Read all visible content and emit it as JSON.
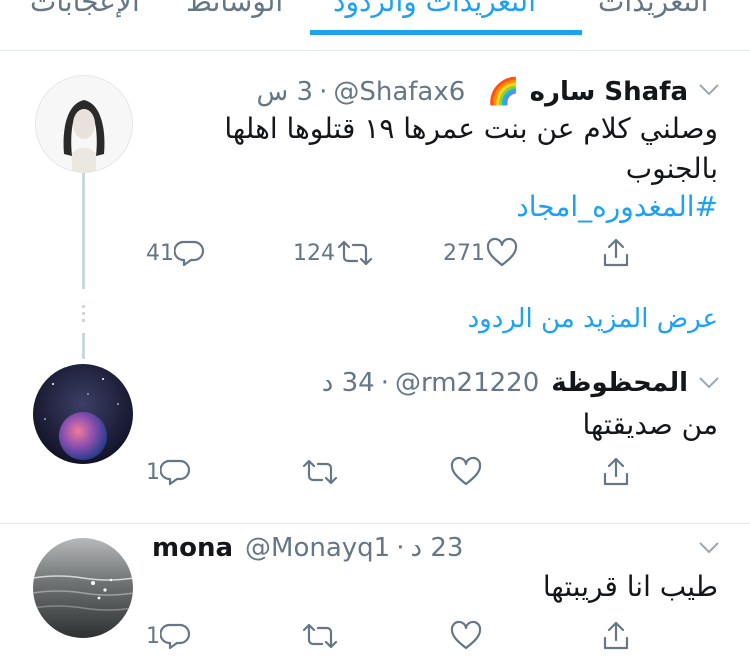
{
  "tabs": [
    "الإعجابات",
    "الوسائط",
    "التغريدات والردود",
    "التغريدات"
  ],
  "main_tweet": {
    "name": "Shafa ساره",
    "emoji": "🌈",
    "handle": "@Shafax6",
    "time": "3 س",
    "text_line1": "وصلني كلام عن بنت عمرها ١٩ قتلوها اهلها",
    "text_line2": "بالجنوب",
    "hashtag": "#المغدوره_امجاد",
    "replies": "41",
    "retweets": "124",
    "likes": "271"
  },
  "more_replies_label": "عرض المزيد من الردود",
  "reply1": {
    "name": "المحظوظة",
    "handle": "@rm21220",
    "time": "34 د",
    "text": "من صديقتها",
    "replies": "1"
  },
  "reply2": {
    "name": "mona",
    "handle": "@Monayq1",
    "time": "23 د",
    "text": "طيب انا قريبتها",
    "replies": "1"
  },
  "icons": [
    "reply-icon",
    "retweet-icon",
    "like-icon",
    "share-icon",
    "chevron-down-icon",
    "rainbow-emoji"
  ],
  "colors": {
    "accent": "#1da1f2",
    "muted": "#657786",
    "border": "#e1e8ed"
  }
}
